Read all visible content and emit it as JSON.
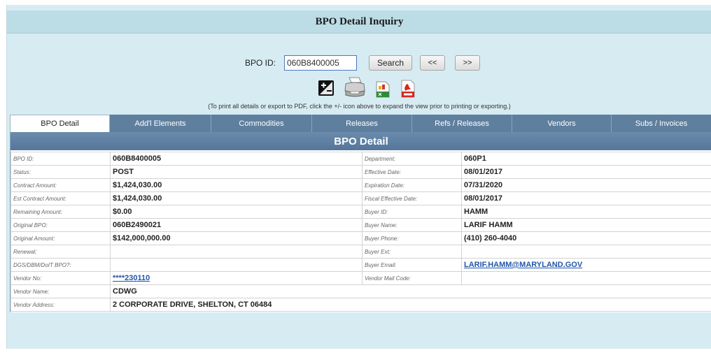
{
  "page": {
    "title": "BPO Detail Inquiry"
  },
  "search": {
    "label": "BPO ID:",
    "value": "060B8400005",
    "search_label": "Search",
    "prev_label": "<<",
    "next_label": ">>"
  },
  "toolbar_icons": [
    "expand-collapse-icon",
    "printer-icon",
    "excel-export-icon",
    "pdf-export-icon"
  ],
  "note": "(To print all details or export to PDF, click the +/- icon above to expand the view prior to printing or exporting.)",
  "tabs": [
    {
      "label": "BPO Detail",
      "active": true
    },
    {
      "label": "Add'l Elements"
    },
    {
      "label": "Commodities"
    },
    {
      "label": "Releases"
    },
    {
      "label": "Refs / Releases"
    },
    {
      "label": "Vendors"
    },
    {
      "label": "Subs / Invoices"
    }
  ],
  "detail": {
    "heading": "BPO Detail",
    "rows": [
      {
        "l1": "BPO ID:",
        "v1": "060B8400005",
        "l2": "Department:",
        "v2": "060P1"
      },
      {
        "l1": "Status:",
        "v1": "POST",
        "l2": "Effective Date:",
        "v2": "08/01/2017"
      },
      {
        "l1": "Contract Amount:",
        "v1": "$1,424,030.00",
        "l2": "Expiration Date:",
        "v2": "07/31/2020"
      },
      {
        "l1": "Est Contract Amount:",
        "v1": "$1,424,030.00",
        "l2": "Fiscal Effective Date:",
        "v2": "08/01/2017"
      },
      {
        "l1": "Remaining Amount:",
        "v1": "$0.00",
        "l2": "Buyer ID:",
        "v2": "HAMM"
      },
      {
        "l1": "Original BPO:",
        "v1": "060B2490021",
        "l2": "Buyer Name:",
        "v2": "LARIF HAMM"
      },
      {
        "l1": "Original Amount:",
        "v1": "$142,000,000.00",
        "l2": "Buyer Phone:",
        "v2": "(410) 260-4040"
      },
      {
        "l1": "Renewal:",
        "v1": "",
        "l2": "Buyer Ext:",
        "v2": ""
      },
      {
        "l1": "DGS/DBM/DoIT BPO?:",
        "v1": "",
        "l2": "Buyer Email:",
        "v2": "LARIF.HAMM@MARYLAND.GOV"
      },
      {
        "l1": "Vendor No:",
        "v1": "****230110",
        "l2": "Vendor Mail Code:",
        "v2": ""
      }
    ],
    "vendor_name_label": "Vendor Name:",
    "vendor_name": "CDWG",
    "vendor_address_label": "Vendor Address:",
    "vendor_address": "2 CORPORATE DRIVE, SHELTON, CT 06484"
  },
  "colors": {
    "background": "#d7ecf2",
    "title_bar": "#bcdce6",
    "tab": "#5f7f9e",
    "panel_header": "#5f7f9e",
    "link": "#2255aa"
  }
}
